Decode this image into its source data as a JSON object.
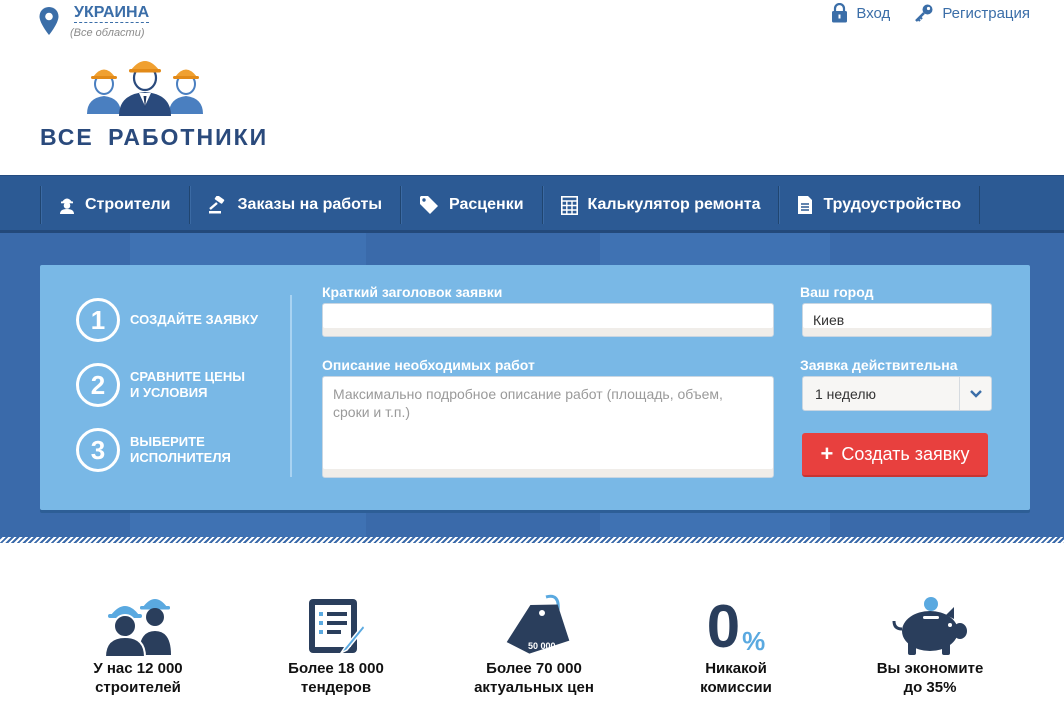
{
  "region": {
    "name": "УКРАИНА",
    "sub": "(Все области)"
  },
  "auth": {
    "login": "Вход",
    "register": "Регистрация"
  },
  "logo": {
    "text": "ВСЕ РАБОТНИКИ"
  },
  "nav": {
    "items": [
      {
        "label": "Строители",
        "icon": "worker-icon"
      },
      {
        "label": "Заказы на работы",
        "icon": "gavel-icon"
      },
      {
        "label": "Расценки",
        "icon": "tag-icon"
      },
      {
        "label": "Калькулятор ремонта",
        "icon": "calculator-icon"
      },
      {
        "label": "Трудоустройство",
        "icon": "document-icon"
      }
    ]
  },
  "steps": [
    {
      "num": "1",
      "label": "СОЗДАЙТЕ ЗАЯВКУ"
    },
    {
      "num": "2",
      "label": "СРАВНИТЕ ЦЕНЫ\nИ УСЛОВИЯ"
    },
    {
      "num": "3",
      "label": "ВЫБЕРИТЕ\nИСПОЛНИТЕЛЯ"
    }
  ],
  "form": {
    "title_label": "Краткий заголовок заявки",
    "title_value": "",
    "description_label": "Описание необходимых работ",
    "description_placeholder": "Максимально подробное описание работ (площадь, объем, сроки и т.п.)",
    "city_label": "Ваш город",
    "city_value": "Киев",
    "validity_label": "Заявка действительна",
    "validity_value": "1 неделю",
    "submit_label": "Создать заявку",
    "submit_icon": "+"
  },
  "features": [
    {
      "text": "У нас 12 000\nстроителей",
      "icon": "builders-icon"
    },
    {
      "text": "Более 18 000\nтендеров",
      "icon": "tender-list-icon"
    },
    {
      "text": "Более 70 000\nактуальных цен",
      "icon": "price-tag-icon",
      "badge": "50 000"
    },
    {
      "text": "Никакой\nкомиссии",
      "icon": "zero-percent-icon",
      "big": "0",
      "small": "%"
    },
    {
      "text": "Вы экономите\nдо 35%",
      "icon": "piggy-bank-icon"
    }
  ],
  "colors": {
    "brand_blue": "#2c5a94",
    "hero_blue": "#3a6aaa",
    "card_blue": "#79b8e6",
    "accent_red": "#e8403e",
    "helmet_orange": "#f0a030",
    "link_blue": "#3b6ea8"
  }
}
